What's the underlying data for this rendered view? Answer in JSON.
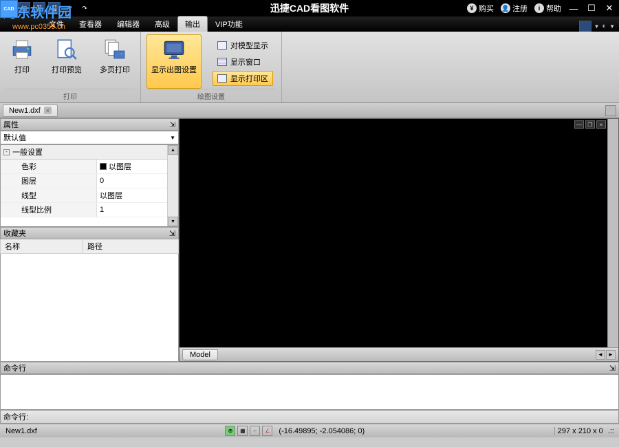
{
  "app_title": "迅捷CAD看图软件",
  "watermark": {
    "text": "河东软件园",
    "url": "www.pc0359.cn",
    "badge": "CAD"
  },
  "titlebar": {
    "buy": "购买",
    "register": "注册",
    "help": "帮助"
  },
  "tabs": [
    "文件",
    "查看器",
    "编辑器",
    "高级",
    "输出",
    "VIP功能"
  ],
  "active_tab_index": 4,
  "ribbon": {
    "group_print": {
      "title": "打印",
      "print": "打印",
      "preview": "打印预览",
      "multi": "多页打印"
    },
    "group_plot": {
      "title": "绘图设置",
      "layout": "显示出图设置",
      "opts": [
        "对模型显示",
        "显示窗口",
        "显示打印区"
      ],
      "opt_active_index": 2
    }
  },
  "document_tab": "New1.dxf",
  "panels": {
    "props_title": "属性",
    "combo_value": "默认值",
    "category": "一般设置",
    "rows": [
      {
        "k": "色彩",
        "v": "以图层",
        "swatch": true
      },
      {
        "k": "图层",
        "v": "0"
      },
      {
        "k": "线型",
        "v": "以图层"
      },
      {
        "k": "线型比例",
        "v": "1"
      }
    ],
    "fav_title": "收藏夹",
    "fav_cols": [
      "名称",
      "路径"
    ]
  },
  "model_tab": "Model",
  "cmd_title": "命令行",
  "cmd_prompt": "命令行:",
  "status": {
    "file": "New1.dxf",
    "coord": "(-16.49895; -2.054086; 0)",
    "dims": "297 x 210 x 0"
  }
}
